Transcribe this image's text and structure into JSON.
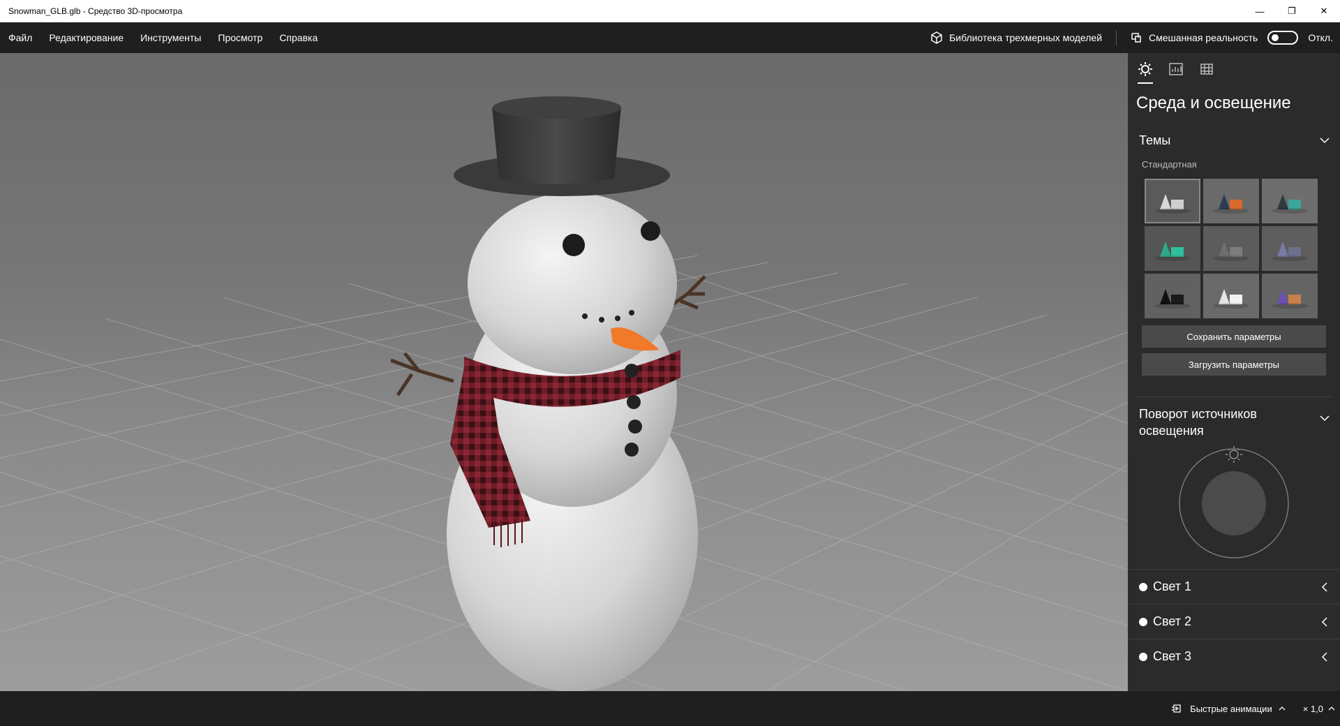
{
  "window": {
    "title": "Snowman_GLB.glb - Средство 3D-просмотра",
    "minimize": "—",
    "restore": "❐",
    "close": "✕"
  },
  "menu": {
    "items": [
      "Файл",
      "Редактирование",
      "Инструменты",
      "Просмотр",
      "Справка"
    ],
    "library_label": "Библиотека трехмерных моделей",
    "mixed_reality_label": "Смешанная реальность",
    "toggle_state": "Откл."
  },
  "panel": {
    "title": "Среда и освещение",
    "themes": {
      "label": "Темы",
      "group": "Стандартная",
      "tiles": [
        {
          "name": "theme-default",
          "bg": "#5a5a5a",
          "c1": "#d8d8d8",
          "c2": "#cfcfcf"
        },
        {
          "name": "theme-orange",
          "bg": "#6a6a6a",
          "c1": "#2f3b55",
          "c2": "#d86a2c"
        },
        {
          "name": "theme-teal",
          "bg": "#6e6e6e",
          "c1": "#2d3a40",
          "c2": "#3aa79b"
        },
        {
          "name": "theme-green",
          "bg": "#555555",
          "c1": "#2fa98d",
          "c2": "#2fbf9e"
        },
        {
          "name": "theme-grey",
          "bg": "#5c5c5c",
          "c1": "#6f6f6f",
          "c2": "#7c7c7c"
        },
        {
          "name": "theme-purple",
          "bg": "#5e5e5e",
          "c1": "#7a7aa8",
          "c2": "#6e6e8e"
        },
        {
          "name": "theme-dark",
          "bg": "#616161",
          "c1": "#111111",
          "c2": "#1a1a1a"
        },
        {
          "name": "theme-white",
          "bg": "#6a6a6a",
          "c1": "#e5e5e5",
          "c2": "#f2f2f2"
        },
        {
          "name": "theme-warm",
          "bg": "#646464",
          "c1": "#6c4fb0",
          "c2": "#c97f4c"
        }
      ]
    },
    "save_label": "Сохранить параметры",
    "load_label": "Загрузить параметры",
    "rotation_label": "Поворот источников освещения",
    "lights": [
      "Свет 1",
      "Свет 2",
      "Свет 3"
    ]
  },
  "status": {
    "animations_label": "Быстрые анимации",
    "speed": "× 1,0"
  },
  "colors": {
    "accent": "#ffffff",
    "panel_bg": "#2b2b2b",
    "scarf": "#7a1f2b",
    "carrot": "#f07a2a"
  }
}
